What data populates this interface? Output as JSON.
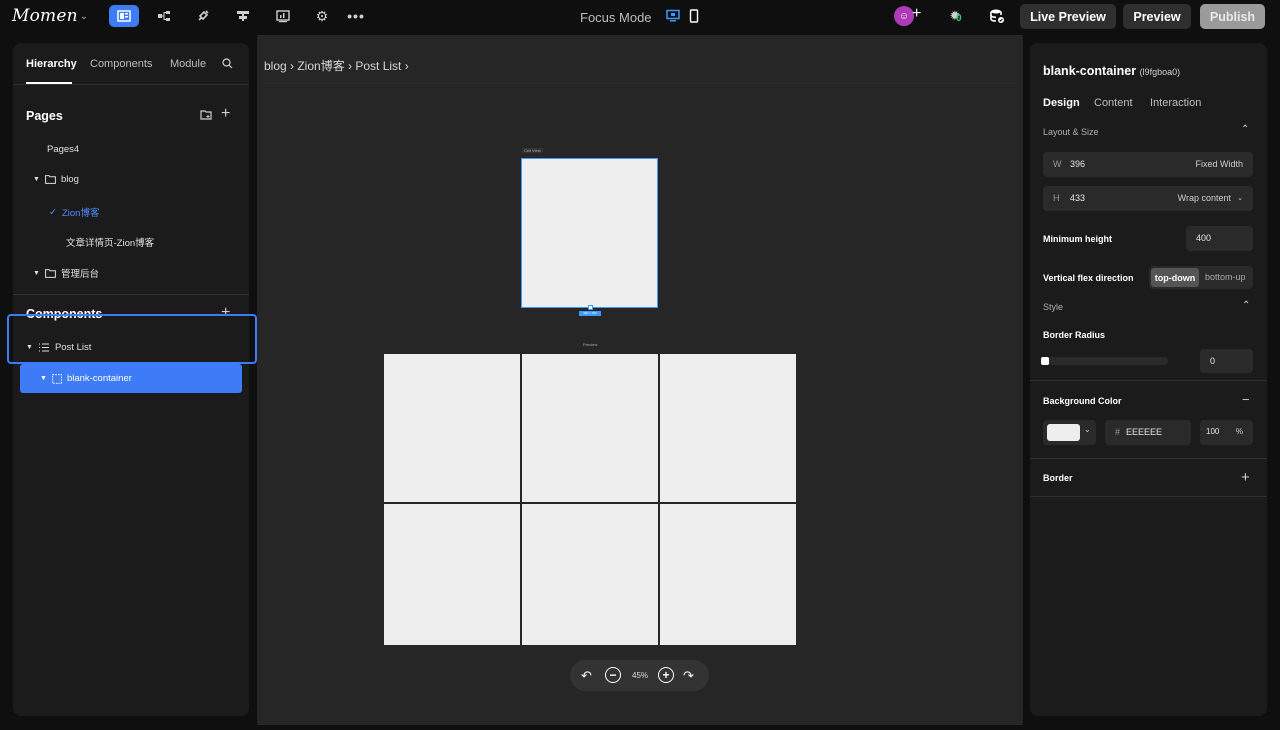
{
  "topbar": {
    "logo": "Momen",
    "focus_mode": "Focus Mode",
    "live_preview": "Live Preview",
    "preview": "Preview",
    "publish": "Publish",
    "debug_count": "0",
    "icons": [
      "pages-icon",
      "logic-flow-icon",
      "plugin-icon",
      "data-model-icon",
      "dashboard-icon",
      "settings-icon",
      "more-icon"
    ]
  },
  "left": {
    "tabs": [
      "Hierarchy",
      "Components",
      "Module"
    ],
    "pages_title": "Pages",
    "pages": [
      {
        "label": "Pages4"
      },
      {
        "label": "blog"
      },
      {
        "label": "Zion博客"
      },
      {
        "label": "文章详情页-Zion博客"
      },
      {
        "label": "管理后台"
      }
    ],
    "components_title": "Components",
    "components": [
      {
        "label": "Post List"
      },
      {
        "label": "blank-container"
      }
    ]
  },
  "canvas": {
    "breadcrumb": "blog › Zion博客 › Post List ›",
    "cell_view_label": "Cell View",
    "size_badge": "396 × 433",
    "preview_label": "Preview",
    "zoom": "45%"
  },
  "right": {
    "title": "blank-container",
    "id": "(l9fgboa0)",
    "tabs": [
      "Design",
      "Content",
      "Interaction"
    ],
    "layout_size": "Layout & Size",
    "width": {
      "key": "W",
      "value": "396",
      "mode": "Fixed Width"
    },
    "height": {
      "key": "H",
      "value": "433",
      "mode": "Wrap content"
    },
    "min_height_label": "Minimum height",
    "min_height_value": "400",
    "flex_label": "Vertical flex direction",
    "flex_on": "top-down",
    "flex_off": "bottom-up",
    "style": "Style",
    "border_radius_label": "Border Radius",
    "border_radius_value": "0",
    "bg_label": "Background Color",
    "hash": "#",
    "bg_hex": "EEEEEE",
    "bg_opacity": "100",
    "percent": "%",
    "border_label": "Border"
  },
  "colors": {
    "accent": "#3d7bf7",
    "panel": "#1b1b1b",
    "canvas": "#262626",
    "swatch": "#eeeeee"
  }
}
